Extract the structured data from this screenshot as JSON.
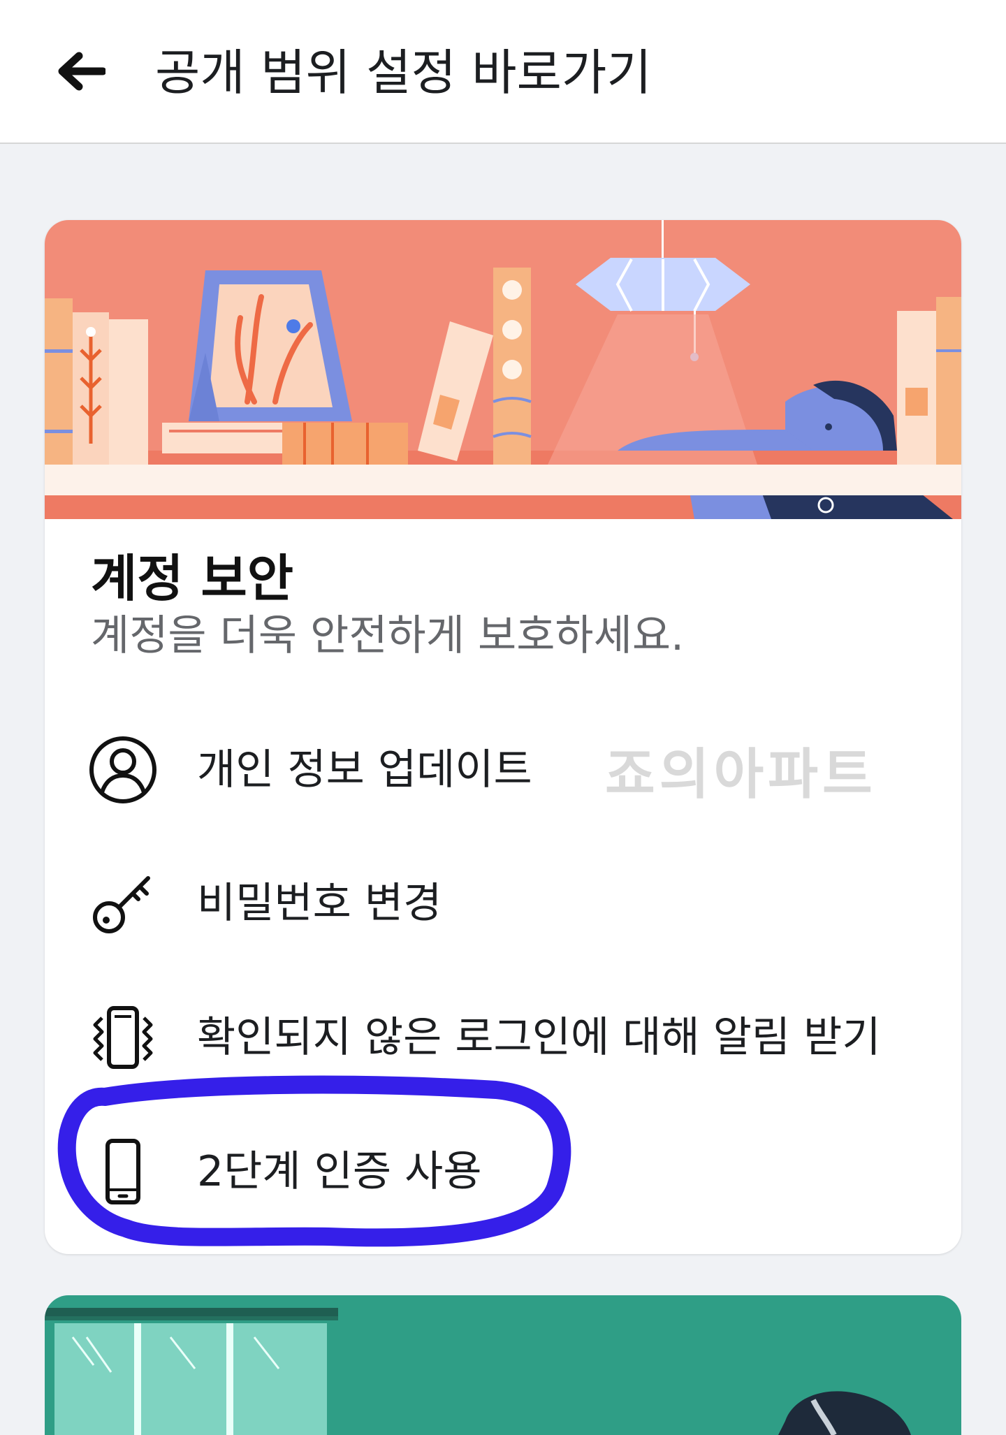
{
  "header": {
    "title": "공개 범위 설정 바로가기",
    "back_icon": "arrow-left-icon"
  },
  "account_security": {
    "title": "계정 보안",
    "subtitle": "계정을 더욱 안전하게 보호하세요.",
    "items": [
      {
        "label": "개인 정보 업데이트",
        "icon": "profile-icon"
      },
      {
        "label": "비밀번호 변경",
        "icon": "key-icon"
      },
      {
        "label": "확인되지 않은 로그인에 대해 알림 받기",
        "icon": "vibrating-phone-icon"
      },
      {
        "label": "2단계 인증 사용",
        "icon": "phone-icon"
      }
    ]
  },
  "watermark": "죠의아파트",
  "colors": {
    "banner_bg": "#f28c78",
    "shelf": "#fdf2ea",
    "highlight_marker": "#2a13e8",
    "next_card_bg": "#2f9e86",
    "subtitle_text": "#65676b"
  }
}
